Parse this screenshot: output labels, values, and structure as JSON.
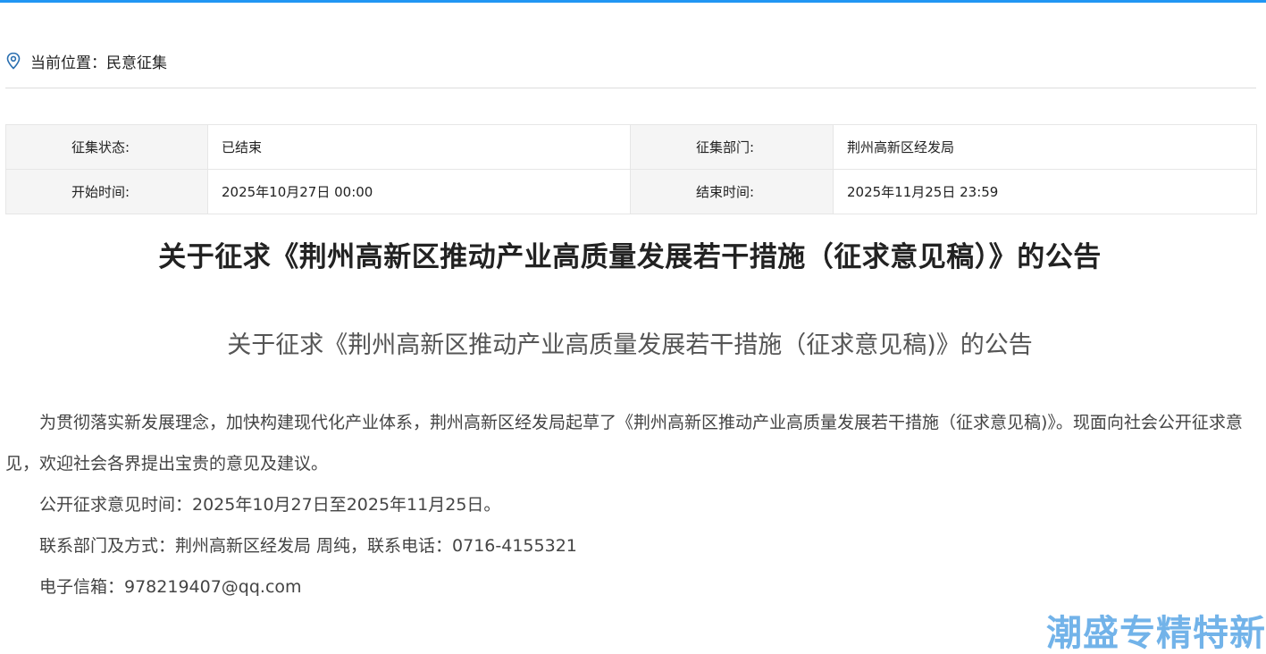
{
  "breadcrumb": {
    "label": "当前位置：民意征集"
  },
  "info_table": {
    "rows": [
      [
        {
          "label": "征集状态:",
          "value": "已结束"
        },
        {
          "label": "征集部门:",
          "value": "荆州高新区经发局"
        }
      ],
      [
        {
          "label": "开始时间:",
          "value": "2025年10月27日 00:00"
        },
        {
          "label": "结束时间:",
          "value": "2025年11月25日 23:59"
        }
      ]
    ]
  },
  "article": {
    "title": "关于征求《荆州高新区推动产业高质量发展若干措施（征求意见稿）》的公告",
    "subtitle": "关于征求《荆州高新区推动产业高质量发展若干措施（征求意见稿)》的公告",
    "paragraphs": [
      "为贯彻落实新发展理念，加快构建现代化产业体系，荆州高新区经发局起草了《荆州高新区推动产业高质量发展若干措施（征求意见稿)》。现面向社会公开征求意见，欢迎社会各界提出宝贵的意见及建议。",
      "公开征求意见时间：2025年10月27日至2025年11月25日。",
      "联系部门及方式：荆州高新区经发局 周纯，联系电话：0716-4155321",
      "电子信箱：978219407@qq.com"
    ]
  },
  "watermark": {
    "text": "潮盛专精特新"
  },
  "colors": {
    "accent": "#2196f3",
    "label_bg": "#f5f5f5",
    "border": "#e6e6e6",
    "watermark": "#5aa6e6"
  },
  "icons": {
    "breadcrumb": "location-pin-icon"
  }
}
